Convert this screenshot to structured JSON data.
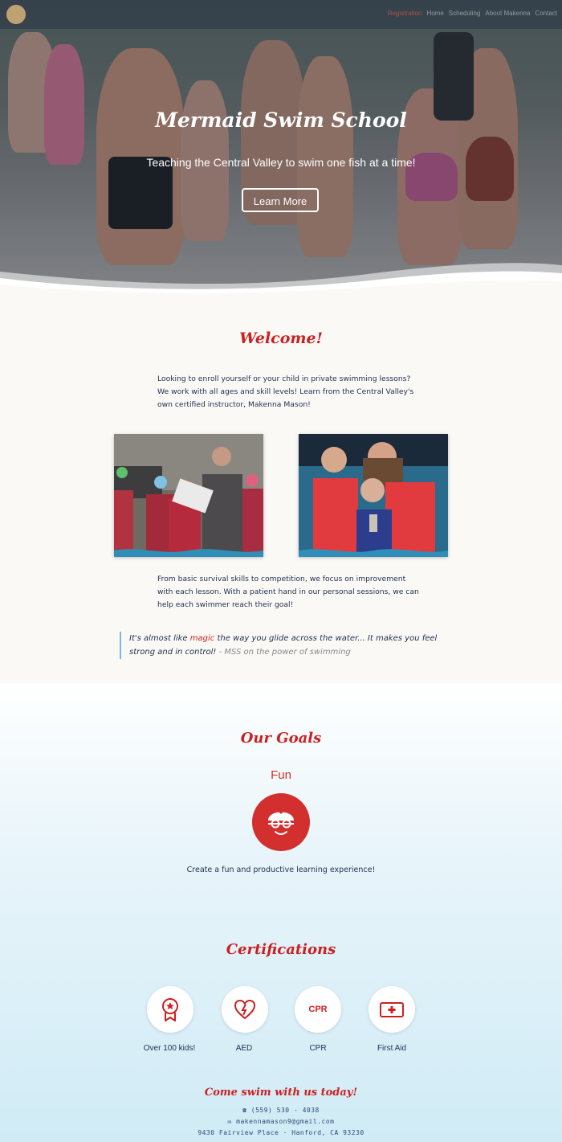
{
  "nav": {
    "links": [
      "Registration",
      "Home",
      "Scheduling",
      "About Makenna",
      "Contact"
    ],
    "active_index": 0
  },
  "hero": {
    "title": "Mermaid Swim School",
    "subtitle": "Teaching the Central Valley to swim one fish at a time!",
    "button": "Learn More"
  },
  "welcome": {
    "heading": "Welcome!",
    "intro_lines": [
      "Looking to enroll yourself or your child in private swimming lessons?",
      "We work with all ages and skill levels! Learn from the Central Valley's",
      "own certified instructor, Makenna Mason!"
    ],
    "body_lines": [
      "From basic survival skills to competition, we focus on improvement",
      "with each lesson. With a patient hand in our personal sessions, we can",
      "help each swimmer reach their goal!"
    ],
    "quote": {
      "pre": "It's almost like ",
      "highlight": "magic",
      "post": " the way you glide across the water... It makes you feel",
      "line2": "strong and in control!",
      "attribution": " - MSS on the power of swimming"
    }
  },
  "goals": {
    "heading": "Our Goals",
    "label": "Fun",
    "icon": "swimmer-face-icon",
    "text": "Create a fun and productive learning experience!"
  },
  "certifications": {
    "heading": "Certifications",
    "items": [
      {
        "label": "Over 100 kids!",
        "icon": "award-ribbon-icon"
      },
      {
        "label": "AED",
        "icon": "heart-bolt-icon"
      },
      {
        "label": "CPR",
        "icon": "cpr-icon",
        "icon_text": "CPR"
      },
      {
        "label": "First Aid",
        "icon": "first-aid-kit-icon"
      }
    ]
  },
  "footer": {
    "cta": "Come swim with us today!",
    "phone": "☎ (559) 530 - 4038",
    "email": "✉ makennamason9@gmail.com",
    "address": "9430 Fairview Place · Hanford, CA 93230"
  },
  "colors": {
    "accent": "#cc2020",
    "text": "#1e2f4d",
    "quote_bar": "#7db7da"
  }
}
